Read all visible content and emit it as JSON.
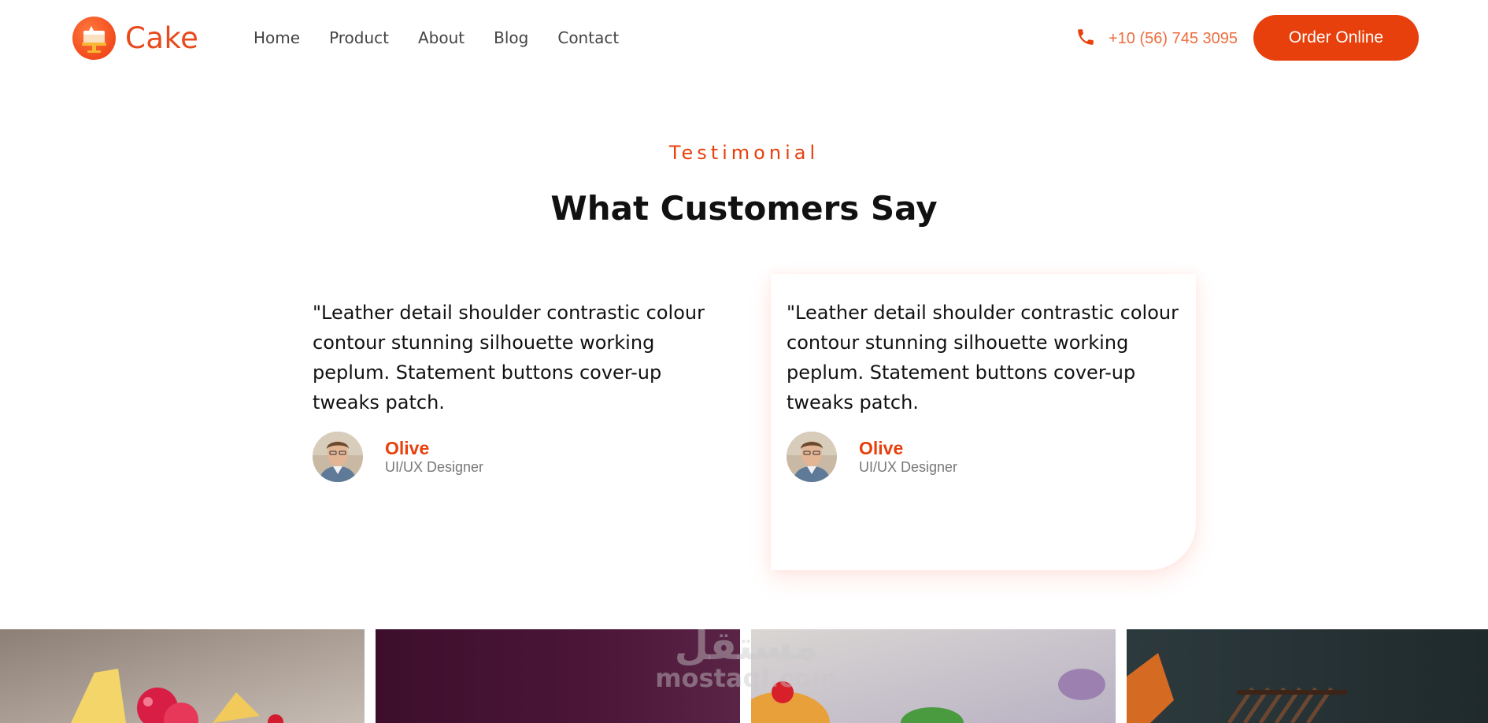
{
  "header": {
    "logo_text": "Cake",
    "nav": [
      "Home",
      "Product",
      "About",
      "Blog",
      "Contact"
    ],
    "phone": "+10 (56) 745 3095",
    "order_button": "Order Online"
  },
  "testimonials": {
    "eyebrow": "Testimonial",
    "title": "What Customers Say",
    "cards": [
      {
        "quote": "\"Leather detail shoulder contrastic colour contour stunning silhouette working peplum. Statement buttons cover-up tweaks patch.",
        "name": "Olive",
        "role": "UI/UX Designer"
      },
      {
        "quote": "\"Leather detail shoulder contrastic colour contour stunning silhouette working peplum. Statement buttons cover-up tweaks patch.",
        "name": "Olive",
        "role": "UI/UX Designer"
      }
    ]
  },
  "watermark": {
    "arabic": "مستقل",
    "latin": "mostaql.com"
  },
  "colors": {
    "accent": "#e8400c",
    "phone_text": "#ec6e3e",
    "muted": "#777777"
  },
  "icons": {
    "logo": "cake-logo-icon",
    "phone": "phone-icon"
  }
}
